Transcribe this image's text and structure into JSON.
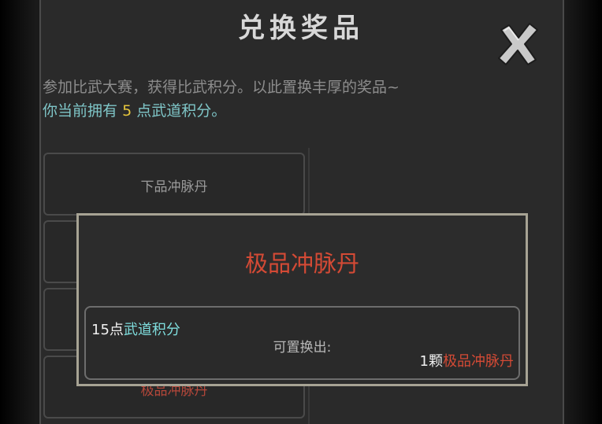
{
  "header": {
    "title": "兑换奖品"
  },
  "intro": {
    "description": "参加比武大赛，获得比武积分。以此置换丰厚的奖品~",
    "points_prefix": "你当前拥有",
    "points_value": "5",
    "points_suffix": "点武道积分。"
  },
  "rewards_list": [
    {
      "label": "下品冲脉丹"
    },
    {
      "label": ""
    },
    {
      "label": ""
    },
    {
      "label": "极品冲脉丹"
    }
  ],
  "modal": {
    "title": "极品冲脉丹",
    "cost_amount": "15点",
    "cost_currency": "武道积分",
    "exchange_label": "可置换出:",
    "reward_count": "1颗",
    "reward_item": "极品冲脉丹"
  },
  "colors": {
    "accent_red": "#d44a35",
    "accent_cyan": "#7fdede",
    "points_yellow": "#e6c63c",
    "modal_border": "#a7a394"
  },
  "icons": {
    "close": "close-icon"
  }
}
